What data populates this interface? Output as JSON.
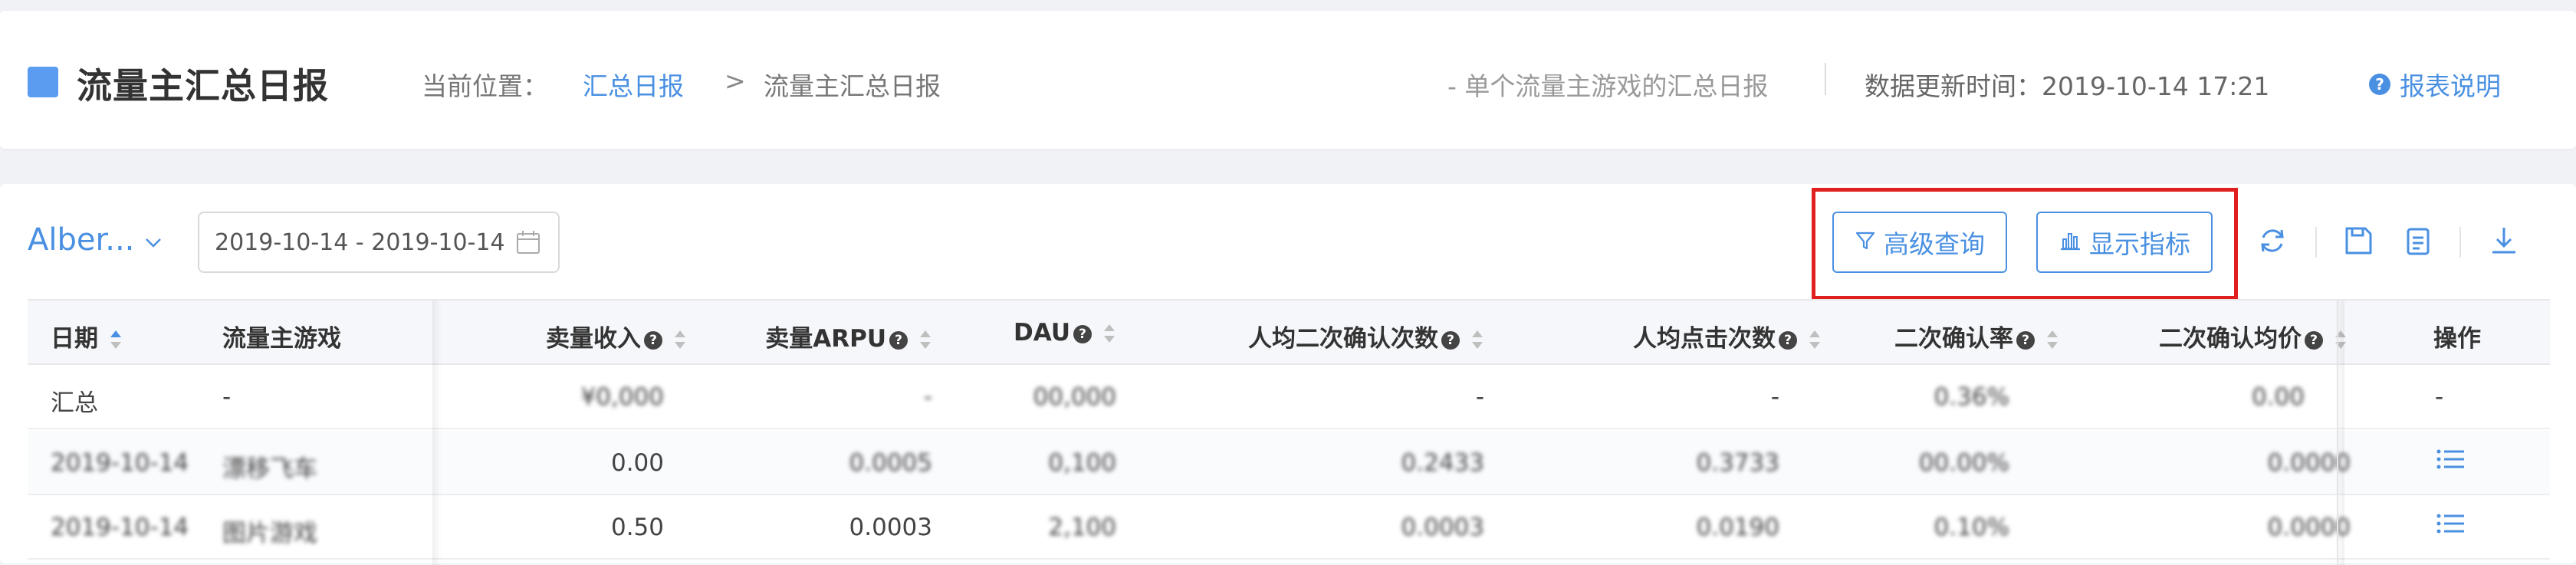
{
  "header": {
    "title": "流量主汇总日报",
    "breadcrumb_label": "当前位置：",
    "breadcrumb_link": "汇总日报",
    "breadcrumb_sep": ">",
    "breadcrumb_current": "流量主汇总日报",
    "description": "- 单个流量主游戏的汇总日报",
    "updated": "数据更新时间：2019-10-14 17:21",
    "help_label": "报表说明",
    "accent_color": "#4a90e2"
  },
  "toolbar": {
    "project": "Alber...",
    "date_range": "2019-10-14 - 2019-10-14",
    "query_label": "高级查询",
    "metrics_label": "显示指标",
    "highlight_color": "#e01f1f"
  },
  "table": {
    "columns": [
      "日期",
      "流量主游戏",
      "卖量收入",
      "卖量ARPU",
      "DAU",
      "人均二次确认次数",
      "人均点击次数",
      "二次确认率",
      "二次确认均价",
      "操作"
    ],
    "rows": [
      [
        "汇总",
        "-",
        "¥0,000",
        "-",
        "00,000",
        "-",
        "-",
        "0.36%",
        "0.00",
        "-"
      ],
      [
        "2019-10-14",
        "漂移飞车",
        "0.00",
        "0.0005",
        "0,100",
        "0.2433",
        "0.3733",
        "00.00%",
        "0.0000",
        ""
      ],
      [
        "2019-10-14",
        "图片游戏",
        "0.50",
        "0.0003",
        "2,100",
        "0.0003",
        "0.0190",
        "0.10%",
        "0.0000",
        ""
      ]
    ]
  }
}
